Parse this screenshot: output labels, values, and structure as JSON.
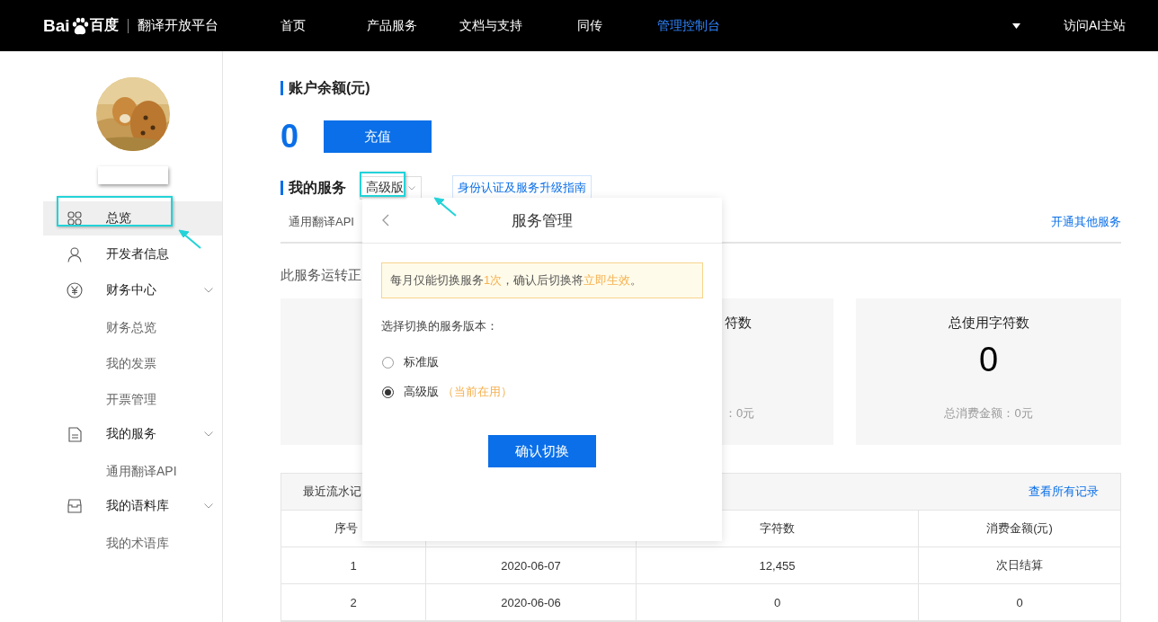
{
  "header": {
    "logo_left": "Bai",
    "logo_right": "百度",
    "platform": "翻译开放平台",
    "nav": [
      {
        "label": "首页",
        "selected": false
      },
      {
        "label": "产品服务",
        "selected": false
      },
      {
        "label": "文档与支持",
        "selected": false
      },
      {
        "label": "同传",
        "selected": false
      },
      {
        "label": "管理控制台",
        "selected": true
      }
    ],
    "site_link": "访问AI主站"
  },
  "sidebar": {
    "items": [
      {
        "label": "总览",
        "kind": "grid",
        "selected": true
      },
      {
        "label": "开发者信息",
        "kind": "user",
        "selected": false
      },
      {
        "label": "财务中心",
        "kind": "yen",
        "selected": false,
        "expanded": true,
        "children": [
          {
            "label": "财务总览",
            "selected": false
          },
          {
            "label": "我的发票",
            "selected": false
          },
          {
            "label": "开票管理",
            "selected": false
          }
        ]
      },
      {
        "label": "我的服务",
        "kind": "doc",
        "selected": false,
        "expanded": true,
        "children": [
          {
            "label": "通用翻译API",
            "selected": false
          }
        ]
      },
      {
        "label": "我的语料库",
        "kind": "box",
        "selected": false,
        "expanded": true,
        "children": [
          {
            "label": "我的术语库",
            "selected": false
          }
        ]
      }
    ]
  },
  "balance": {
    "heading": "账户余额(元)",
    "amount": "0",
    "button": "充值"
  },
  "service": {
    "heading": "我的服务",
    "plan": "高级版",
    "guide_link": "身份认证及服务升级指南",
    "tab": "通用翻译API",
    "other_link": "开通其他服务",
    "status": "此服务运转正",
    "cards": [
      {
        "kind": "covered"
      },
      {
        "kind": "partial",
        "title": "符数",
        "footer": "：0元"
      },
      {
        "kind": "full",
        "title": "总使用字符数",
        "value": "0",
        "footer": "总消费金额：0元"
      }
    ]
  },
  "records": {
    "title": "最近流水记",
    "all_link": "查看所有记录",
    "columns": [
      {
        "kind": "text",
        "label": "序号"
      },
      {
        "kind": "covered"
      },
      {
        "kind": "text",
        "label": "字符数"
      },
      {
        "kind": "text",
        "label": "消费金额(元)"
      }
    ],
    "rows": [
      [
        "1",
        "2020-06-07",
        "12,455",
        "次日结算"
      ],
      [
        "2",
        "2020-06-06",
        "0",
        "0"
      ]
    ]
  },
  "dialog": {
    "title": "服务管理",
    "notice": [
      {
        "text": "每月仅能切换服务",
        "highlight": false
      },
      {
        "text": "1次",
        "highlight": true
      },
      {
        "text": "，确认后切换将",
        "highlight": false
      },
      {
        "text": "立即生效",
        "highlight": true
      },
      {
        "text": "。",
        "highlight": false
      }
    ],
    "prompt": "选择切换的服务版本：",
    "options": [
      {
        "label": "标准版",
        "selected": false
      },
      {
        "label": "高级版",
        "note": "（当前在用）",
        "selected": true
      }
    ],
    "confirm": "确认切换"
  }
}
